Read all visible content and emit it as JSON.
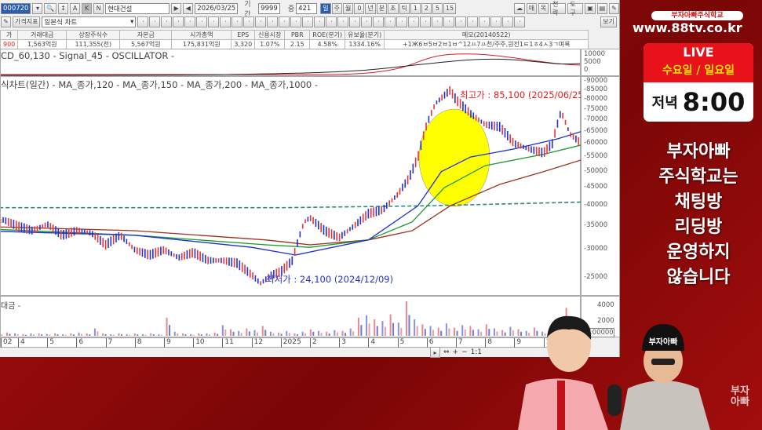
{
  "toolbar": {
    "code": "000720",
    "mode_a": "A",
    "mode_k": "K",
    "mode_n": "N",
    "name": "현대건설",
    "date": "2026/03/25",
    "period_label": "기간",
    "period_value": "9999",
    "count_label": "중",
    "count_value": "421",
    "timeframes": [
      "일",
      "주",
      "월",
      "0",
      "년",
      "분",
      "초",
      "틱",
      "1",
      "2",
      "5",
      "15"
    ],
    "right_buttons": [
      "매",
      "목",
      "전략",
      "도구"
    ],
    "indicator_btn": "가격지표",
    "chart_type": "일본식 차트",
    "view_btn": "보기"
  },
  "info": {
    "headers": [
      "가",
      "거래대금",
      "상장주식수",
      "자본금",
      "시가총액",
      "EPS",
      "신용시장",
      "PBR",
      "ROE(분기)",
      "유보율(분기)",
      "메모(20140522)"
    ],
    "values": [
      "900",
      "1,563억원",
      "111,355(천)",
      "5,567억원",
      "175,831억원",
      "3,320",
      "1.07%",
      "2.15",
      "4.58%",
      "1334.16%",
      "+1Ж6ㅂ5ㅂ2ㅂ1ㅂ^12ㅛ7ㅛ천/주주,원전1ㅌ1ㅎ4ㅅ3ㄱ며록"
    ]
  },
  "macd": {
    "legend": "CD_60,130 - Signal_45 - OSCILLATOR -",
    "ticks": [
      "10000",
      "5000",
      "0"
    ]
  },
  "price_legend": "식차트(일간) - MA_종가,120 - MA_종가,150 - MA_종가,200 - MA_종가,1000 -",
  "volume": {
    "legend": "대금 -",
    "ticks": [
      "4000",
      "2000"
    ],
    "unit": "*100000"
  },
  "annotations": {
    "high": "최고가 : 85,100 (2025/06/25)",
    "low": "최저가 : 24,100 (2024/12/09)"
  },
  "overlay": {
    "school": "부자아빠주식학교",
    "url": "www.88tv.co.kr",
    "live": "LIVE",
    "days": "수요일 / 일요일",
    "evening": "저녁",
    "time": "8:00",
    "notice": [
      "부자아빠",
      "주식학교는",
      "채팅방",
      "리딩방",
      "운영하지",
      "않습니다"
    ],
    "watermark": "부자아빠",
    "cap": "부자아빠"
  },
  "colors": {
    "up": "#e8323a",
    "down": "#2230d0",
    "ma120": "#1a2fd8",
    "ma150": "#1a9a2a",
    "ma200": "#a0301a",
    "ma1000": "#2a8a7a",
    "highlight": "#ffff00"
  },
  "chart_data": {
    "type": "line",
    "title": "현대건설 일간 차트",
    "yscale": "log",
    "ylim": [
      23000,
      92000
    ],
    "yticks": [
      25000,
      30000,
      35000,
      40000,
      45000,
      50000,
      55000,
      60000,
      65000,
      70000,
      75000,
      80000,
      85000,
      90000
    ],
    "xticks": [
      {
        "t": 2,
        "label": "02"
      },
      {
        "t": 4,
        "label": "4"
      },
      {
        "t": 5,
        "label": "5"
      },
      {
        "t": 6,
        "label": "6"
      },
      {
        "t": 7,
        "label": "7"
      },
      {
        "t": 8,
        "label": "8"
      },
      {
        "t": 9,
        "label": "9"
      },
      {
        "t": 10,
        "label": "10"
      },
      {
        "t": 11,
        "label": "11"
      },
      {
        "t": 12,
        "label": "12"
      },
      {
        "t": 13,
        "label": "2025"
      },
      {
        "t": 14,
        "label": "2"
      },
      {
        "t": 15,
        "label": "3"
      },
      {
        "t": 16,
        "label": "4"
      },
      {
        "t": 17,
        "label": "5"
      },
      {
        "t": 18,
        "label": "6"
      },
      {
        "t": 19,
        "label": "7"
      },
      {
        "t": 20,
        "label": "8"
      },
      {
        "t": 21,
        "label": "9"
      },
      {
        "t": 22,
        "label": "10"
      }
    ],
    "series": [
      {
        "name": "종가",
        "points": [
          [
            2.5,
            36000
          ],
          [
            3,
            35000
          ],
          [
            3.5,
            36500
          ],
          [
            4,
            35000
          ],
          [
            4.5,
            34000
          ],
          [
            5,
            35500
          ],
          [
            5.5,
            33000
          ],
          [
            6,
            34000
          ],
          [
            6.5,
            33500
          ],
          [
            7,
            31000
          ],
          [
            7.5,
            33000
          ],
          [
            8,
            30000
          ],
          [
            8.5,
            29000
          ],
          [
            9,
            30000
          ],
          [
            9.5,
            28500
          ],
          [
            10,
            29500
          ],
          [
            10.5,
            28000
          ],
          [
            11,
            28000
          ],
          [
            11.5,
            27500
          ],
          [
            12,
            25500
          ],
          [
            12.3,
            24100
          ],
          [
            12.7,
            25500
          ],
          [
            13,
            26000
          ],
          [
            13.4,
            28000
          ],
          [
            13.8,
            36000
          ],
          [
            14,
            37000
          ],
          [
            14.5,
            34000
          ],
          [
            15,
            32500
          ],
          [
            15.5,
            35000
          ],
          [
            16,
            38000
          ],
          [
            16.5,
            39000
          ],
          [
            17,
            43000
          ],
          [
            17.4,
            48000
          ],
          [
            17.7,
            55000
          ],
          [
            18,
            68000
          ],
          [
            18.3,
            78000
          ],
          [
            18.8,
            85100
          ],
          [
            19,
            80000
          ],
          [
            19.5,
            73000
          ],
          [
            20,
            68000
          ],
          [
            20.5,
            67000
          ],
          [
            21,
            60000
          ],
          [
            21.5,
            58000
          ],
          [
            22,
            56500
          ],
          [
            22.3,
            60000
          ],
          [
            22.6,
            74000
          ],
          [
            22.9,
            64000
          ],
          [
            23.2,
            61000
          ]
        ]
      },
      {
        "name": "MA_종가,120",
        "points": [
          [
            2.5,
            34000
          ],
          [
            8,
            33000
          ],
          [
            12,
            30500
          ],
          [
            13.5,
            29000
          ],
          [
            16,
            32000
          ],
          [
            17.7,
            40000
          ],
          [
            18.5,
            50000
          ],
          [
            19.5,
            55000
          ],
          [
            21,
            58000
          ],
          [
            22.5,
            62000
          ],
          [
            23.3,
            65000
          ]
        ]
      },
      {
        "name": "MA_종가,150",
        "points": [
          [
            2.5,
            34500
          ],
          [
            8,
            33000
          ],
          [
            12.5,
            31000
          ],
          [
            14,
            30500
          ],
          [
            16,
            32000
          ],
          [
            17.5,
            36000
          ],
          [
            18.6,
            45000
          ],
          [
            20,
            52000
          ],
          [
            22,
            56000
          ],
          [
            23.3,
            59500
          ]
        ]
      },
      {
        "name": "MA_종가,200",
        "points": [
          [
            2.5,
            35000
          ],
          [
            8,
            34000
          ],
          [
            12.5,
            32000
          ],
          [
            14,
            31000
          ],
          [
            16,
            32000
          ],
          [
            17.5,
            34000
          ],
          [
            18.8,
            40000
          ],
          [
            20.5,
            46000
          ],
          [
            22,
            50000
          ],
          [
            23.3,
            54000
          ]
        ]
      },
      {
        "name": "MA_종가,1000",
        "points": [
          [
            2.5,
            39500
          ],
          [
            13,
            39500
          ],
          [
            18,
            40000
          ],
          [
            23.3,
            41000
          ]
        ]
      }
    ],
    "volume": [
      3,
      3,
      2,
      3,
      4,
      3,
      2,
      3,
      3,
      2,
      3,
      2,
      3,
      4,
      3,
      9,
      3,
      2,
      3,
      2,
      3,
      2,
      3,
      2,
      22,
      5,
      3,
      2,
      3,
      3,
      4,
      13,
      8,
      6,
      9,
      7,
      12,
      5,
      4,
      6,
      3,
      5,
      8,
      6,
      5,
      7,
      6,
      9,
      22,
      25,
      20,
      18,
      26,
      16,
      42,
      20,
      14,
      12,
      10,
      15,
      10,
      13,
      12,
      8,
      14,
      9,
      7,
      11,
      8,
      6,
      10,
      5,
      7,
      18,
      34,
      10
    ]
  }
}
